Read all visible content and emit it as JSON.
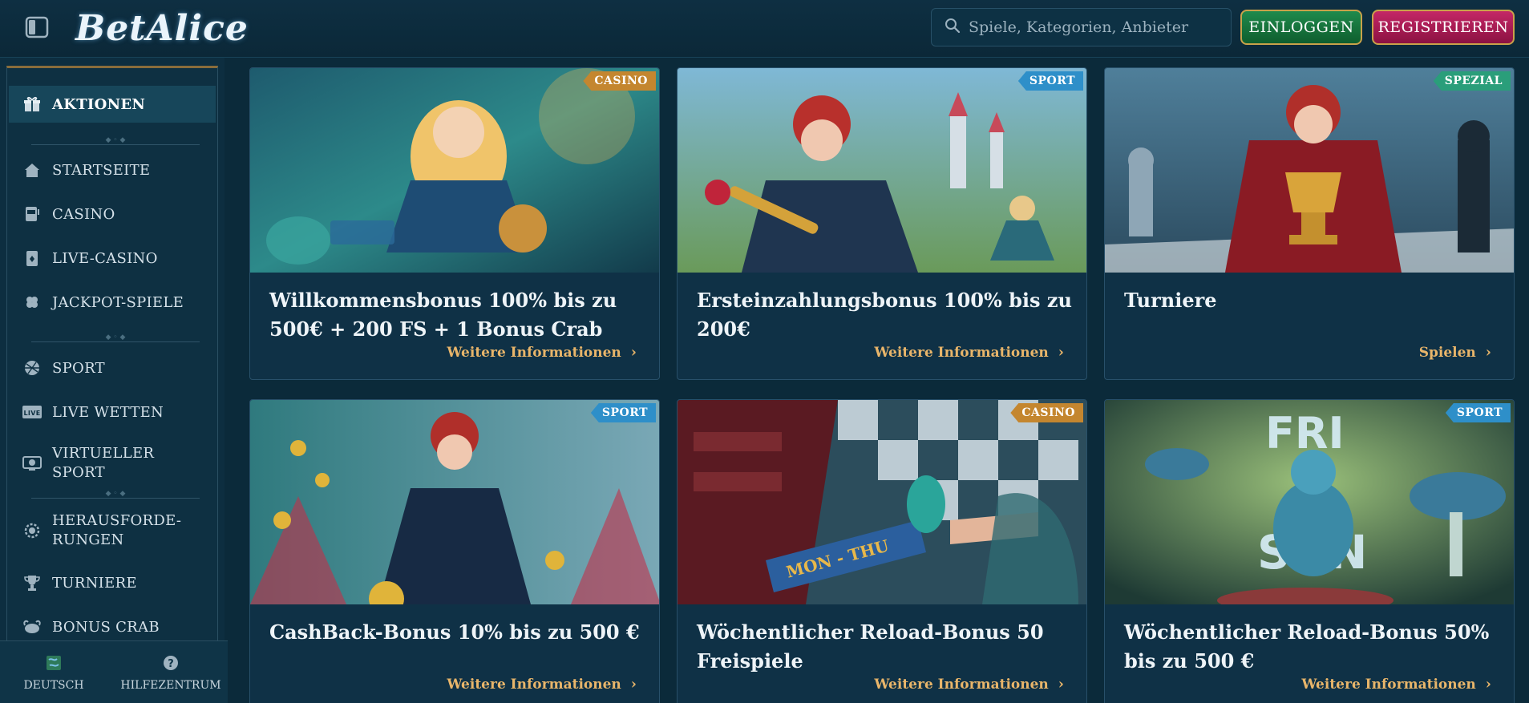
{
  "header": {
    "logo": "BetAlice",
    "search_placeholder": "Spiele, Kategorien, Anbieter",
    "login_label": "EINLOGGEN",
    "register_label": "REGISTRIEREN"
  },
  "sidebar": {
    "items": [
      {
        "label": "AKTIONEN",
        "icon": "gift-icon"
      },
      {
        "label": "STARTSEITE",
        "icon": "home-icon"
      },
      {
        "label": "CASINO",
        "icon": "slot-machine-icon"
      },
      {
        "label": "LIVE-CASINO",
        "icon": "card-icon"
      },
      {
        "label": "JACKPOT-SPIELE",
        "icon": "clover-icon"
      },
      {
        "label": "SPORT",
        "icon": "ball-icon"
      },
      {
        "label": "LIVE WETTEN",
        "icon": "live-icon"
      },
      {
        "label": "VIRTUELLER SPORT",
        "icon": "virtual-sport-icon"
      },
      {
        "label": "HERAUSFORDE- RUNGEN",
        "icon": "challenge-icon"
      },
      {
        "label": "TURNIERE",
        "icon": "trophy-icon"
      },
      {
        "label": "BONUS CRAB",
        "icon": "crab-icon"
      }
    ],
    "footer": {
      "language_label": "DEUTSCH",
      "help_label": "HILFEZENTRUM"
    }
  },
  "cards": [
    {
      "badge": "CASINO",
      "title": "Willkommensbonus 100% bis zu 500€ + 200 FS + 1 Bonus Crab",
      "link": "Weitere Informationen"
    },
    {
      "badge": "SPORT",
      "title": "Ersteinzahlungsbonus 100% bis zu 200€",
      "link": "Weitere Informationen"
    },
    {
      "badge": "SPEZIAL",
      "title": "Turniere",
      "link": "Spielen"
    },
    {
      "badge": "SPORT",
      "title": "CashBack-Bonus 10% bis zu 500 €",
      "link": "Weitere Informationen"
    },
    {
      "badge": "CASINO",
      "title": "Wöchentlicher Reload-Bonus 50 Freispiele",
      "link": "Weitere Informationen"
    },
    {
      "badge": "SPORT",
      "title": "Wöchentlicher Reload-Bonus 50% bis zu 500 €",
      "link": "Weitere Informationen"
    }
  ],
  "colors": {
    "background": "#0b2a3a",
    "accent_gold": "#e8b56a",
    "login_green": "#1f8a4c",
    "register_pink": "#c42766",
    "badge_casino": "#c4862f",
    "badge_sport": "#2e8fc9",
    "badge_spezial": "#2a9e7a"
  }
}
